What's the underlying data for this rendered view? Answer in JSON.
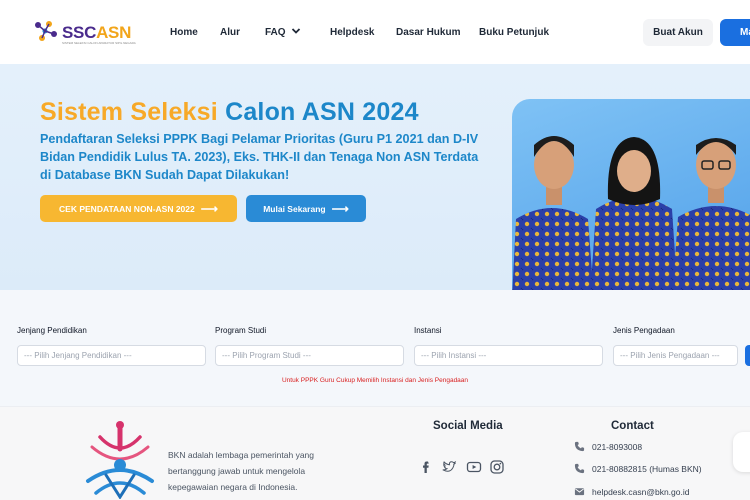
{
  "brand": {
    "name_part1": "SSC",
    "name_part2": "ASN",
    "tagline": "SISTEM SELEKSI CALON APARATUR SIPIL NEGARA"
  },
  "nav": {
    "home": "Home",
    "alur": "Alur",
    "faq": "FAQ",
    "helpdesk": "Helpdesk",
    "dasar_hukum": "Dasar Hukum",
    "buku_petunjuk": "Buku Petunjuk",
    "buat_akun": "Buat Akun",
    "masuk": "Ma"
  },
  "hero": {
    "title_part1": "Sistem Seleksi",
    "title_part2": "Calon ASN 2024",
    "description": "Pendaftaran Seleksi PPPK Bagi Pelamar Prioritas (Guru P1 2021 dan D-IV Bidan Pendidik Lulus TA. 2023), Eks. THK-II dan Tenaga Non ASN Terdata di Database BKN Sudah Dapat Dilakukan!",
    "btn_cek": "CEK PENDATAAN NON-ASN 2022",
    "btn_mulai": "Mulai Sekarang"
  },
  "filter": {
    "jenjang_label": "Jenjang Pendidikan",
    "jenjang_placeholder": "--- Pilih Jenjang Pendidikan ---",
    "prodi_label": "Program Studi",
    "prodi_placeholder": "--- Pilih Program Studi ---",
    "instansi_label": "Instansi",
    "instansi_placeholder": "--- Pilih Instansi ---",
    "pengadaan_label": "Jenis Pengadaan",
    "pengadaan_placeholder": "--- Pilih Jenis Pengadaan ---",
    "note": "Untuk PPPK Guru Cukup Memilih Instansi dan Jenis Pengadaan"
  },
  "footer": {
    "about": "BKN adalah lembaga pemerintah yang bertanggung jawab untuk mengelola kepegawaian negara di Indonesia.",
    "social_heading": "Social Media",
    "contact_heading": "Contact",
    "phone1": "021-8093008",
    "phone2": "021-80882815 (Humas BKN)",
    "email": "helpdesk.casn@bkn.go.id"
  },
  "colors": {
    "primary_blue": "#1a6fe0",
    "hero_blue": "#1d87c9",
    "accent_orange": "#f7a928",
    "note_red": "#d92020"
  },
  "icons": [
    "facebook-icon",
    "twitter-icon",
    "youtube-icon",
    "instagram-icon",
    "phone-icon",
    "mail-icon",
    "chevron-down-icon",
    "arrow-right-icon"
  ]
}
